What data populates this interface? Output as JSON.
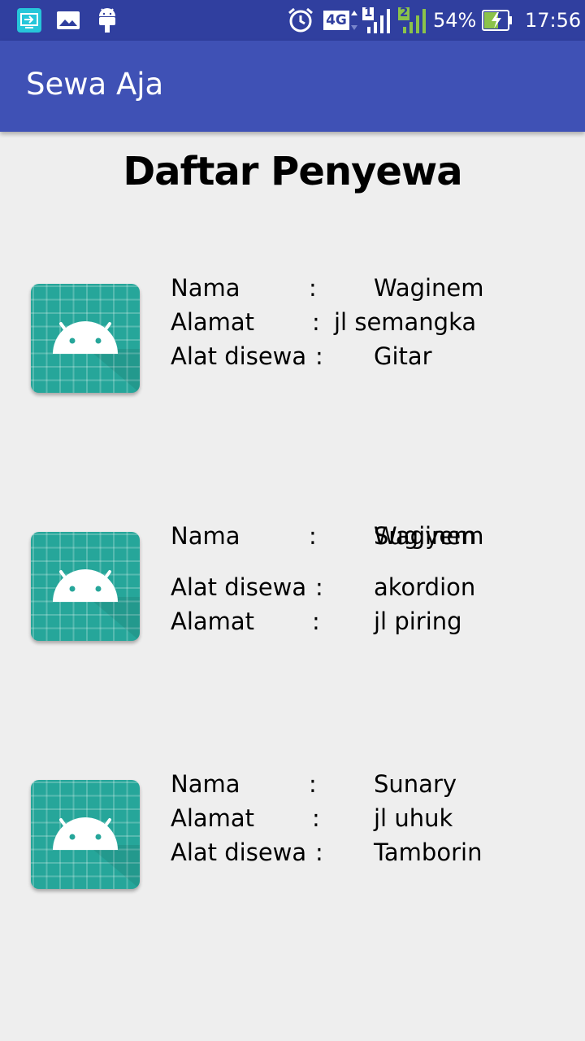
{
  "status_bar": {
    "battery": "54%",
    "time": "17:56",
    "network": "4G",
    "sim1": "1",
    "sim2": "2",
    "icons": [
      "screen-mirror-icon",
      "gallery-icon",
      "android-debug-icon",
      "alarm-icon",
      "signal-sim1-icon",
      "signal-sim2-icon",
      "battery-charging-icon"
    ]
  },
  "app_bar": {
    "title": "Sewa Aja"
  },
  "page": {
    "title": "Daftar Penyewa"
  },
  "list": {
    "items": [
      {
        "icon": "android-app-icon",
        "line1": {
          "label": "Nama",
          "sep": ":",
          "value": "Waginem"
        },
        "line2": {
          "label": "Alamat",
          "sep": ":",
          "value": "jl semangka"
        },
        "line3": {
          "label": "Alat disewa",
          "sep": ":",
          "value": "Gitar"
        }
      },
      {
        "icon": "android-app-icon",
        "line1": {
          "label": "Nama",
          "sep": ":",
          "value": "Waginem",
          "value_overlap": "Sugiyem"
        },
        "line2": {
          "label": "Alat disewa",
          "sep": ":",
          "value": "akordion"
        },
        "line3": {
          "label": "Alamat",
          "sep": ":",
          "value": "jl piring"
        }
      },
      {
        "icon": "android-app-icon",
        "line1": {
          "label": "Nama",
          "sep": ":",
          "value": "Sunary"
        },
        "line2": {
          "label": "Alamat",
          "sep": ":",
          "value": "jl uhuk"
        },
        "line3": {
          "label": "Alat disewa",
          "sep": ":",
          "value": "Tamborin"
        }
      }
    ]
  },
  "colors": {
    "status_bar": "#303f9f",
    "app_bar": "#3f51b5",
    "background": "#eeeeee",
    "icon_bg": "#26a69a"
  }
}
